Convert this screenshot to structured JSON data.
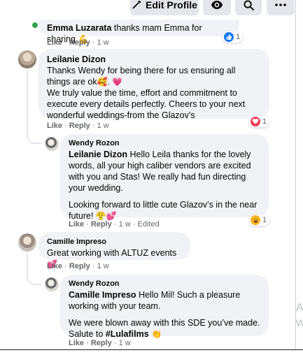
{
  "toolbar": {
    "edit_label": "Edit Profile"
  },
  "comments": [
    {
      "author": "Emma Luzarata",
      "text": "thanks mam Emma for sharing",
      "emoji": "💪",
      "reaction": {
        "icon": "like-icon",
        "count": "1"
      },
      "actions": {
        "like": "Like",
        "reply": "Reply",
        "time": "1 w"
      }
    },
    {
      "author": "Leilanie Dizon",
      "line1": "Thanks Wendy for being there for us ensuring all things are ok",
      "line1_emoji": "🥰. 💗",
      "line2": "We truly value the time, effort and commitment to execute every details perfectly. Cheers to your next wonderful weddings-from the Glazov’s",
      "reaction": {
        "icon": "love-icon",
        "count": "1"
      },
      "actions": {
        "like": "Like",
        "reply": "Reply",
        "time": "1 w"
      }
    },
    {
      "author": "Wendy Rozon",
      "mention": "Leilanie Dizon",
      "para1": "Hello Leila thanks for the lovely words, all your high caliber vendors are excited with you and Stas! We really had fun directing your wedding.",
      "para2": "Looking forward to little cute Glazov’s in the near future!",
      "para2_emoji": "😤💕",
      "reaction": {
        "icon": "haha-icon",
        "count": "1"
      },
      "actions": {
        "like": "Like",
        "reply": "Reply",
        "time": "1 w",
        "edited": "Edited"
      }
    },
    {
      "author": "Camille Impreso",
      "text": "Great working with ALTUZ events",
      "emoji": "💕",
      "actions": {
        "like": "Like",
        "reply": "Reply",
        "time": "1 w"
      }
    },
    {
      "author": "Wendy Rozon",
      "mention": "Camille Impreso",
      "para1": "Hello Mil! Such a pleasure working with your team.",
      "para2": "We were blown away with this SDE you’ve made. Salute to",
      "para2_tag": "#Lulafilms",
      "para2_emoji": "👏",
      "actions": {
        "like": "Like",
        "reply": "Reply",
        "time": "1 w"
      }
    }
  ],
  "sep": "·",
  "edge_chars": {
    "a": "A",
    "w": "W"
  },
  "colors": {
    "like_blue": "#1877f2",
    "love_red": "#f33e58",
    "haha_yellow": "#f7b125"
  }
}
